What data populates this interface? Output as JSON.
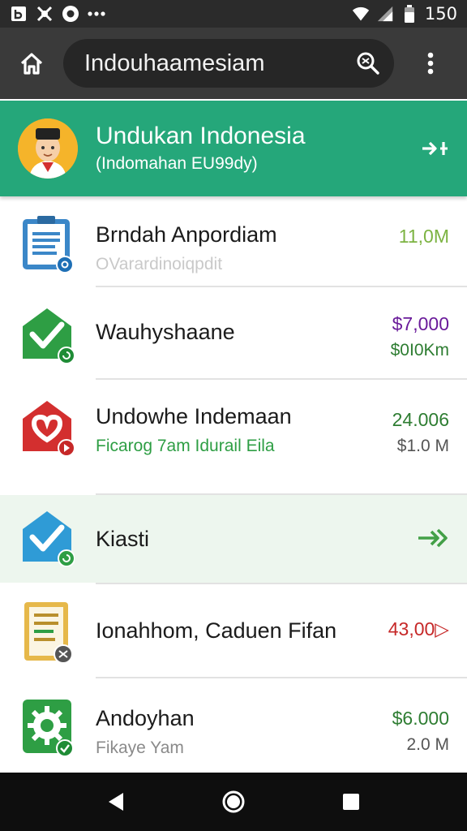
{
  "status_bar": {
    "time": "150"
  },
  "browser": {
    "url": "Indouhaamesiam"
  },
  "header": {
    "title": "Undukan Indonesia",
    "subtitle": "(Indomahan EU99dy)",
    "color": "#25a77a"
  },
  "items": [
    {
      "title": "Brndah Anpordiam",
      "subtitle": "OVarardinoiqpdit",
      "amount1": "11,0M",
      "amount1_color": "#7cb342",
      "amount2": "",
      "icon": "document-icon",
      "badge": "blue"
    },
    {
      "title": "Wauhyshaane",
      "subtitle": "",
      "amount1": "$7,000",
      "amount1_color": "#6a1b9a",
      "amount2": "$0I0Km",
      "amount2_color": "#2e7d32",
      "icon": "check-envelope-icon",
      "badge": "green"
    },
    {
      "title": "Undowhe Indemaan",
      "subtitle": "Ficarog 7am Idurail Eila",
      "amount1": "24.006",
      "amount1_color": "#2e7d32",
      "amount2": "$1.0 M",
      "icon": "heart-envelope-icon",
      "badge": "red"
    },
    {
      "title": "Kiasti",
      "subtitle": "",
      "amount1": "",
      "amount2": "",
      "icon": "check-envelope-blue-icon",
      "badge": "green",
      "selected": true
    },
    {
      "title": "Ionahhom, Caduen Fifan",
      "subtitle": "",
      "amount1": "43,00▷",
      "amount1_color": "#c62828",
      "amount2": "",
      "icon": "notes-icon",
      "badge": "dark"
    },
    {
      "title": "Andoyhan",
      "subtitle": "Fikaye Yam",
      "amount1": "$6.000",
      "amount1_color": "#2e7d32",
      "amount2": "2.0 M",
      "icon": "gear-app-icon",
      "badge": "green"
    }
  ]
}
